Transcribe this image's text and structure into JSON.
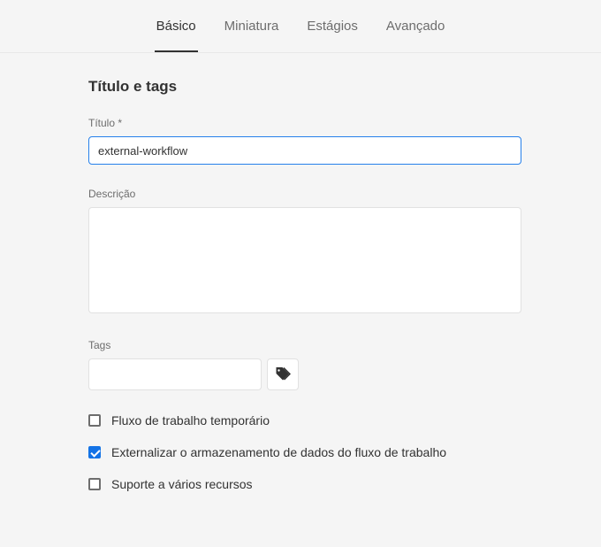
{
  "tabs": [
    {
      "label": "Básico",
      "active": true
    },
    {
      "label": "Miniatura",
      "active": false
    },
    {
      "label": "Estágios",
      "active": false
    },
    {
      "label": "Avançado",
      "active": false
    }
  ],
  "section": {
    "title": "Título e tags"
  },
  "fields": {
    "title": {
      "label": "Título *",
      "value": "external-workflow"
    },
    "description": {
      "label": "Descrição",
      "value": ""
    },
    "tags": {
      "label": "Tags",
      "value": "",
      "icon": "tag-icon"
    }
  },
  "checkboxes": [
    {
      "label": "Fluxo de trabalho temporário",
      "checked": false
    },
    {
      "label": "Externalizar o armazenamento de dados do fluxo de trabalho",
      "checked": true
    },
    {
      "label": "Suporte a vários recursos",
      "checked": false
    }
  ]
}
